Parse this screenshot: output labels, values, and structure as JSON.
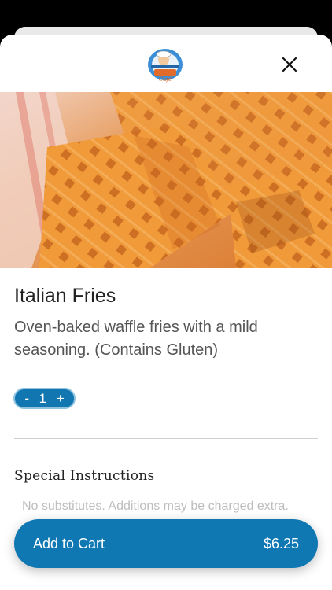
{
  "header": {
    "logo_icon": "gourmet-pizza-deli-cafe-logo",
    "close_icon": "close-icon"
  },
  "item": {
    "name": "Italian Fries",
    "description": "Oven-baked waffle fries with a mild seasoning. (Contains Gluten)",
    "image": "waffle-fries-photo"
  },
  "quantity": {
    "decrement_label": "-",
    "value": "1",
    "increment_label": "+"
  },
  "special_instructions": {
    "label": "Special Instructions",
    "value": "",
    "placeholder": "No substitutes. Additions may be charged extra."
  },
  "cart": {
    "label": "Add to Cart",
    "price": "$6.25"
  },
  "colors": {
    "accent": "#0f78b3",
    "stepper_border": "#8fc3e0",
    "fries": "#e98a2c"
  }
}
